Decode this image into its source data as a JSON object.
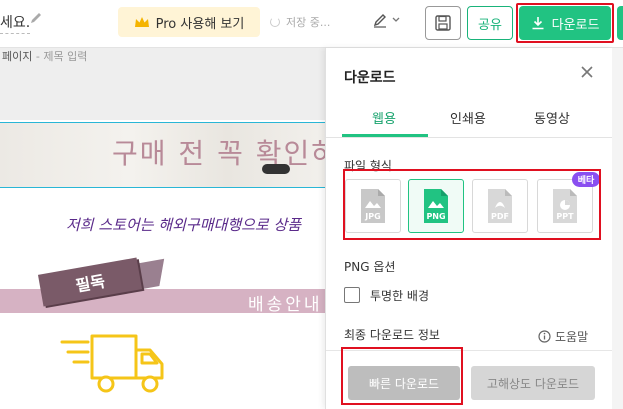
{
  "header": {
    "title_fragment": "세요.",
    "pro_label": "Pro 사용해 보기",
    "save_status": "저장 중...",
    "share_label": "공유",
    "download_label": "다운로드",
    "brand_color": "#21c382"
  },
  "canvas": {
    "page_label": "페이지",
    "page_title_placeholder": "- 제목 입력",
    "banner_text": "구매 전 꼭 확인하",
    "banner_chip": "",
    "store_text": "저희 스토어는 해외구매대행으로 상품",
    "ribbon_tag": "필독",
    "shipping_text": "배송안내"
  },
  "panel": {
    "title": "다운로드",
    "tabs": [
      "웹용",
      "인쇄용",
      "동영상"
    ],
    "active_tab": "웹용",
    "file_format_label": "파일 형식",
    "formats": [
      {
        "label": "JPG",
        "selected": false
      },
      {
        "label": "PNG",
        "selected": true
      },
      {
        "label": "PDF",
        "selected": false
      },
      {
        "label": "PPT",
        "selected": false
      }
    ],
    "beta_badge": "베타",
    "png_options_label": "PNG 옵션",
    "transparent_label": "투명한 배경",
    "transparent_checked": false,
    "last_download_label": "최종 다운로드 정보",
    "help_label": "도움말",
    "quick_download_label": "빠른 다운로드",
    "hires_download_label": "고해상도 다운로드"
  }
}
